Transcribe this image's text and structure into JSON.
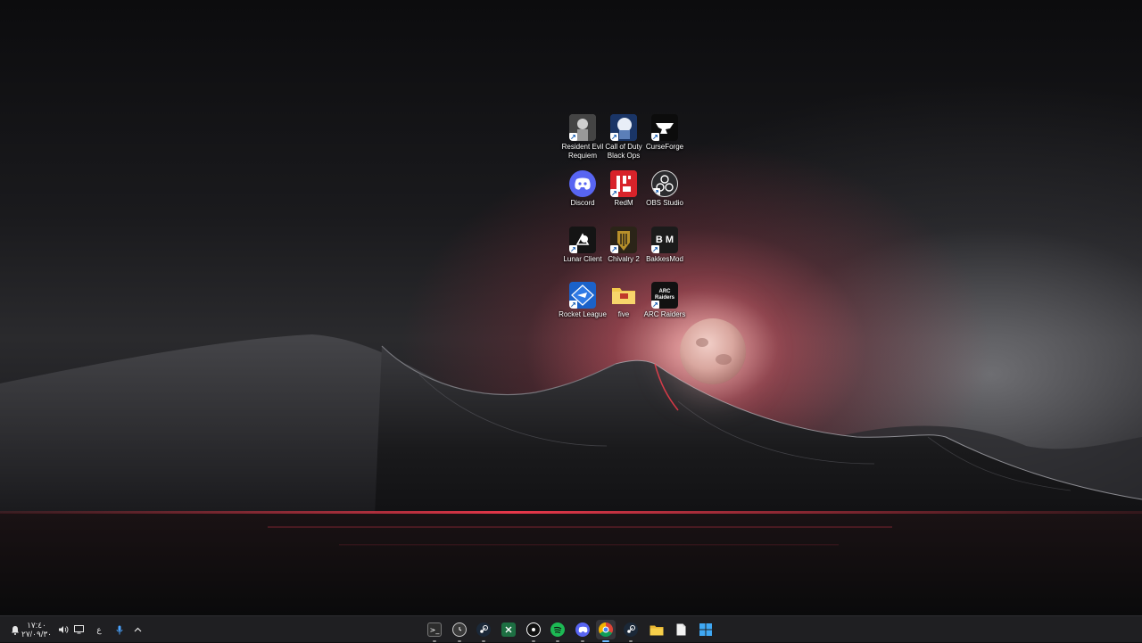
{
  "desktop": {
    "icons": [
      {
        "label": "Resident Evil Requiem",
        "icon": "resident-evil-icon"
      },
      {
        "label": "Call of Duty Black Ops",
        "icon": "call-of-duty-icon"
      },
      {
        "label": "CurseForge",
        "icon": "curseforge-icon"
      },
      {
        "label": "Discord",
        "icon": "discord-icon"
      },
      {
        "label": "RedM",
        "icon": "redm-icon"
      },
      {
        "label": "OBS Studio",
        "icon": "obs-icon"
      },
      {
        "label": "Lunar Client",
        "icon": "lunar-client-icon"
      },
      {
        "label": "Chivalry 2",
        "icon": "chivalry-icon"
      },
      {
        "label": "BakkesMod",
        "icon": "bakkesmod-icon"
      },
      {
        "label": "Rocket League",
        "icon": "rocket-league-icon"
      },
      {
        "label": "five",
        "icon": "folder-icon"
      },
      {
        "label": "ARC Raiders",
        "icon": "arc-raiders-icon"
      }
    ],
    "icon_glyphs": {
      "bakkesmod": "B M",
      "arc_raiders": "ARC Raiders"
    }
  },
  "taskbar": {
    "clock_time": "١٧:٤٠",
    "clock_date": "٢٧/٠٩/٣٠",
    "language": "ع",
    "apps": [
      {
        "name": "terminal-icon"
      },
      {
        "name": "clock-app-icon"
      },
      {
        "name": "steam-icon"
      },
      {
        "name": "excel-icon"
      },
      {
        "name": "ea-app-icon"
      },
      {
        "name": "spotify-icon"
      },
      {
        "name": "discord-icon"
      },
      {
        "name": "chrome-icon",
        "active": true
      },
      {
        "name": "steam-icon"
      },
      {
        "name": "file-explorer-icon"
      },
      {
        "name": "notepad-icon"
      },
      {
        "name": "start-icon"
      }
    ],
    "colors": {
      "accent": "#6cb8ff",
      "background": "#1f1f22"
    }
  }
}
